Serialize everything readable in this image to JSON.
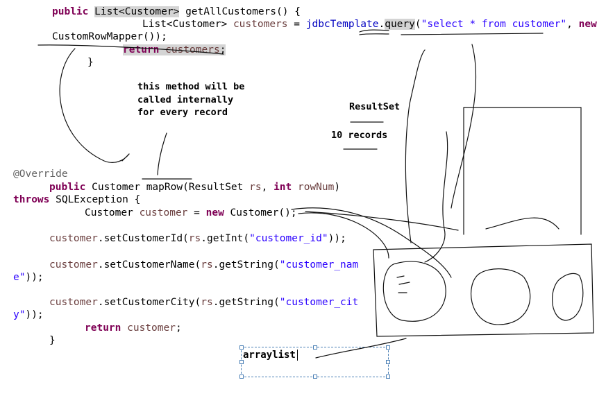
{
  "code_top": {
    "l1_kw": "public",
    "l1_type": "List<Customer>",
    "l1_method": " getAllCustomers() {",
    "l2_type": "List<Customer>",
    "l2_var": " customers",
    "l2_eq": " = ",
    "l2_field": "jdbcTemplate",
    "l2_dot": ".",
    "l2_query": "query",
    "l2_open": "(",
    "l2_str": "\"select * from customer\"",
    "l2_comma": ", ",
    "l2_new": "new",
    "l3": "CustomRowMapper());",
    "l4_kw": "return",
    "l4_var": " customers",
    "l4_semi": ";",
    "l5": "}"
  },
  "notes": {
    "method_note": [
      "this method will be",
      "called internally",
      "for every record"
    ],
    "resultset": "ResultSet",
    "records": "10 records",
    "arraylist": "arraylist"
  },
  "code_bottom": {
    "override": "@Override",
    "m1_kw": "public",
    "m1_rest": " Customer ",
    "m1_name": "mapRow",
    "m1_args1": "(ResultSet ",
    "m1_rs": "rs",
    "m1_comma": ", ",
    "m1_int": "int",
    "m1_rownum": " rowNum",
    "m1_close": ")",
    "throws_kw": "throws",
    "throws_rest": " SQLException {",
    "c1_type": "Customer ",
    "c1_var": "customer",
    "c1_eq": " = ",
    "c1_new": "new",
    "c1_rest": " Customer();",
    "s1_var": "customer",
    "s1_a": ".setCustomerId(",
    "s1_rs": "rs",
    "s1_b": ".getInt(",
    "s1_str": "\"customer_id\"",
    "s1_c": "));",
    "s2_var": "customer",
    "s2_a": ".setCustomerName(",
    "s2_rs": "rs",
    "s2_b": ".getString(",
    "s2_str": "\"customer_nam",
    "s2_wrap": "e\"));",
    "s3_var": "customer",
    "s3_a": ".setCustomerCity(",
    "s3_rs": "rs",
    "s3_b": ".getString(",
    "s3_str": "\"customer_cit",
    "s3_wrap": "y\"));",
    "ret_kw": "return",
    "ret_var": " customer",
    "ret_semi": ";",
    "close": "}"
  }
}
